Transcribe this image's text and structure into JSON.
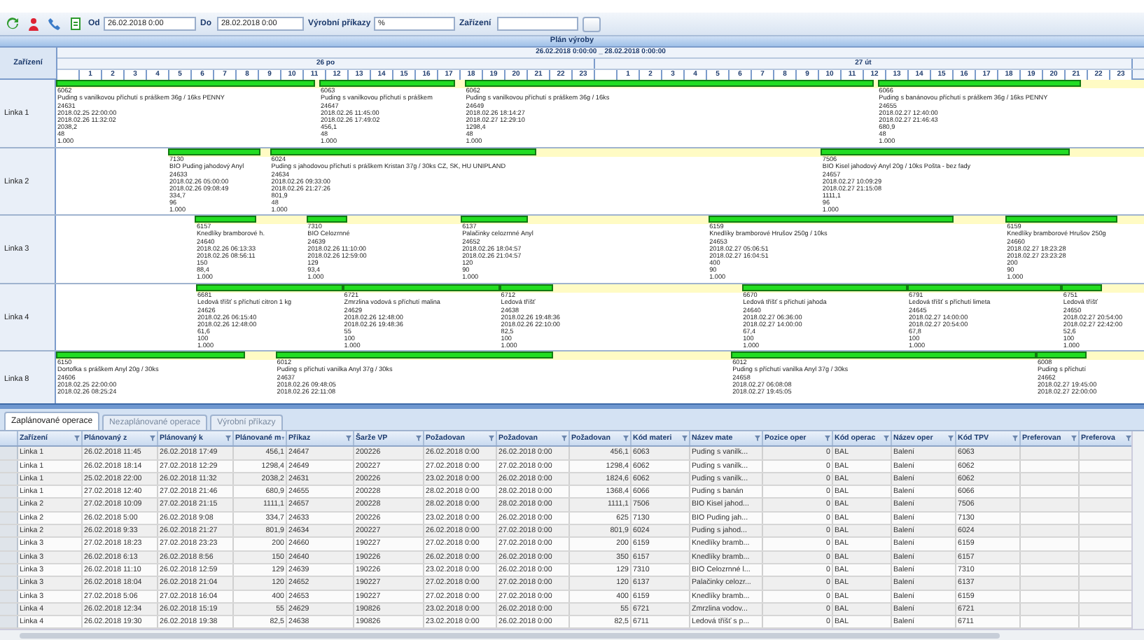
{
  "toolbar": {
    "from_label": "Od",
    "from_value": "26.02.2018 0:00",
    "to_label": "Do",
    "to_value": "28.02.2018 0:00",
    "orders_label": "Výrobní příkazy",
    "orders_value": "%",
    "device_label": "Zařízení"
  },
  "gantt": {
    "title": "Plán výroby",
    "range": "26.02.2018 0:00:00 _ 28.02.2018 0:00:00",
    "resource_header": "Zařízení",
    "days": [
      {
        "label": "26 po",
        "hours": [
          "1",
          "2",
          "3",
          "4",
          "5",
          "6",
          "7",
          "8",
          "9",
          "10",
          "11",
          "12",
          "13",
          "14",
          "15",
          "16",
          "17",
          "18",
          "19",
          "20",
          "21",
          "22",
          "23"
        ]
      },
      {
        "label": "27 út",
        "hours": [
          "1",
          "2",
          "3",
          "4",
          "5",
          "6",
          "7",
          "8",
          "9",
          "10",
          "11",
          "12",
          "13",
          "14",
          "15",
          "16",
          "17",
          "18",
          "19",
          "20",
          "21",
          "22",
          "23"
        ]
      }
    ],
    "resources": [
      {
        "name": "Linka 1",
        "tasks": [
          {
            "code": "6062",
            "name": "Puding s vanilkovou příchutí s práškem 36g / 16ks PENNY",
            "order": "24631",
            "start": "2018.02.25 22:00:00",
            "end": "2018.02.26 11:32:02",
            "lines": [
              "2038,2",
              "48",
              "1.000"
            ]
          },
          {
            "code": "6063",
            "name": "Puding s vanilkovou příchutí s práškem",
            "order": "24647",
            "start": "2018.02.26 11:45:00",
            "end": "2018.02.26 17:49:02",
            "lines": [
              "456,1",
              "48",
              "1.000"
            ]
          },
          {
            "code": "6062",
            "name": "Puding s vanilkovou příchutí s práškem 36g / 16ks",
            "order": "24649",
            "start": "2018.02.26 18:14:27",
            "end": "2018.02.27 12:29:10",
            "lines": [
              "1298,4",
              "48",
              "1.000"
            ]
          },
          {
            "code": "6066",
            "name": "Puding s banánovou příchutí s práškem 36g / 16ks PENNY",
            "order": "24655",
            "start": "2018.02.27 12:40:00",
            "end": "2018.02.27 21:46:43",
            "lines": [
              "680,9",
              "48",
              "1.000"
            ]
          }
        ]
      },
      {
        "name": "Linka 2",
        "tasks": [
          {
            "code": "7130",
            "name": "BIO Puding jahodový Anyl",
            "order": "24633",
            "start": "2018.02.26 05:00:00",
            "end": "2018.02.26 09:08:49",
            "lines": [
              "334,7",
              "96",
              "1.000"
            ]
          },
          {
            "code": "6024",
            "name": "Puding s jahodovou příchutí s práškem Kristan 37g / 30ks CZ, SK, HU UNIPLAND",
            "order": "24634",
            "start": "2018.02.26 09:33:00",
            "end": "2018.02.26 21:27:26",
            "lines": [
              "801,9",
              "48",
              "1.000"
            ]
          },
          {
            "code": "7506",
            "name": "BIO Kisel jahodový Anyl 20g / 10ks Pošta - bez fady",
            "order": "24657",
            "start": "2018.02.27 10:09:29",
            "end": "2018.02.27 21:15:08",
            "lines": [
              "1111,1",
              "96",
              "1.000"
            ]
          }
        ]
      },
      {
        "name": "Linka 3",
        "tasks": [
          {
            "code": "6157",
            "name": "Knedlíky bramborové h.",
            "order": "24640",
            "start": "2018.02.26 06:13:33",
            "end": "2018.02.26 08:56:11",
            "lines": [
              "150",
              "88,4",
              "1.000"
            ]
          },
          {
            "code": "7310",
            "name": "BIO Celozrnné",
            "order": "24639",
            "start": "2018.02.26 11:10:00",
            "end": "2018.02.26 12:59:00",
            "lines": [
              "129",
              "93,4",
              "1.000"
            ]
          },
          {
            "code": "6137",
            "name": "Palačinky celozrnné Anyl",
            "order": "24652",
            "start": "2018.02.26 18:04:57",
            "end": "2018.02.26 21:04:57",
            "lines": [
              "120",
              "90",
              "1.000"
            ]
          },
          {
            "code": "6159",
            "name": "Knedlíky bramborové Hrušov 250g / 10ks",
            "order": "24653",
            "start": "2018.02.27 05:06:51",
            "end": "2018.02.27 16:04:51",
            "lines": [
              "400",
              "90",
              "1.000"
            ]
          },
          {
            "code": "6159",
            "name": "Knedlíky bramborové Hrušov 250g",
            "order": "24660",
            "start": "2018.02.27 18:23:28",
            "end": "2018.02.27 23:23:28",
            "lines": [
              "200",
              "90",
              "1.000"
            ]
          }
        ]
      },
      {
        "name": "Linka 4",
        "tasks": [
          {
            "code": "6681",
            "name": "Ledová tříšť s příchutí citron 1 kg",
            "order": "24626",
            "start": "2018.02.26 06:15:40",
            "end": "2018.02.26 12:48:00",
            "lines": [
              "61,6",
              "100",
              "1.000"
            ]
          },
          {
            "code": "6721",
            "name": "Zmrzlina vodová s příchutí malina",
            "order": "24629",
            "start": "2018.02.26 12:48:00",
            "end": "2018.02.26 19:48:36",
            "lines": [
              "55",
              "100",
              "1.000"
            ]
          },
          {
            "code": "6712",
            "name": "Ledová tříšť",
            "order": "24638",
            "start": "2018.02.26 19:48:36",
            "end": "2018.02.26 22:10:00",
            "lines": [
              "82,5",
              "100",
              "1.000"
            ]
          },
          {
            "code": "6670",
            "name": "Ledová tříšť s příchutí jahoda",
            "order": "24640",
            "start": "2018.02.27 06:36:00",
            "end": "2018.02.27 14:00:00",
            "lines": [
              "67,4",
              "100",
              "1.000"
            ]
          },
          {
            "code": "6791",
            "name": "Ledová tříšť s příchutí limeta",
            "order": "24645",
            "start": "2018.02.27 14:00:00",
            "end": "2018.02.27 20:54:00",
            "lines": [
              "67,8",
              "100",
              "1.000"
            ]
          },
          {
            "code": "6751",
            "name": "Ledová tříšť",
            "order": "24650",
            "start": "2018.02.27 20:54:00",
            "end": "2018.02.27 22:42:00",
            "lines": [
              "52,6",
              "100",
              "1.000"
            ]
          }
        ]
      },
      {
        "name": "Linka 8",
        "tasks": [
          {
            "code": "6150",
            "name": "Dortofka s práškem Anyl 20g / 30ks",
            "order": "24606",
            "start": "2018.02.25 22:00:00",
            "end": "2018.02.26 08:25:24"
          },
          {
            "code": "6012",
            "name": "Puding s příchutí vanilka Anyl 37g / 30ks",
            "order": "24637",
            "start": "2018.02.26 09:48:05",
            "end": "2018.02.26 22:11:08"
          },
          {
            "code": "6012",
            "name": "Puding s příchutí vanilka Anyl 37g / 30ks",
            "order": "24658",
            "start": "2018.02.27 06:08:08",
            "end": "2018.02.27 19:45:05"
          },
          {
            "code": "6008",
            "name": "Puding s příchutí",
            "order": "24662",
            "start": "2018.02.27 19:45:00",
            "end": "2018.02.27 22:00:00"
          }
        ]
      }
    ]
  },
  "tabs": [
    {
      "label": "Zaplánované operace",
      "selected": true
    },
    {
      "label": "Nezaplánované operace",
      "selected": false
    },
    {
      "label": "Výrobní příkazy",
      "selected": false
    }
  ],
  "table": {
    "columns": [
      {
        "label": "Zařízení",
        "kind": "text"
      },
      {
        "label": "Plánovaný z",
        "kind": "text"
      },
      {
        "label": "Plánovaný k",
        "kind": "text"
      },
      {
        "label": "Plánované m",
        "kind": "number"
      },
      {
        "label": "Příkaz",
        "kind": "text"
      },
      {
        "label": "Šarže VP",
        "kind": "text"
      },
      {
        "label": "Požadovan",
        "kind": "text"
      },
      {
        "label": "Požadovan",
        "kind": "text"
      },
      {
        "label": "Požadovan",
        "kind": "number"
      },
      {
        "label": "Kód materi",
        "kind": "text"
      },
      {
        "label": "Název mate",
        "kind": "text"
      },
      {
        "label": "Pozice oper",
        "kind": "number"
      },
      {
        "label": "Kód operac",
        "kind": "text"
      },
      {
        "label": "Název oper",
        "kind": "text"
      },
      {
        "label": "Kód TPV",
        "kind": "text"
      },
      {
        "label": "Preferovan"
      },
      {
        "label": "Preferova"
      }
    ],
    "rows": [
      [
        "Linka 1",
        "26.02.2018 11:45",
        "26.02.2018 17:49",
        "456,1",
        "24647",
        "200226",
        "26.02.2018 0:00",
        "26.02.2018 0:00",
        "456,1",
        "6063",
        "Puding s vanilk...",
        "0",
        "BAL",
        "Balení",
        "6063"
      ],
      [
        "Linka 1",
        "26.02.2018 18:14",
        "27.02.2018 12:29",
        "1298,4",
        "24649",
        "200227",
        "27.02.2018 0:00",
        "27.02.2018 0:00",
        "1298,4",
        "6062",
        "Puding s vanilk...",
        "0",
        "BAL",
        "Balení",
        "6062"
      ],
      [
        "Linka 1",
        "25.02.2018 22:00",
        "26.02.2018 11:32",
        "2038,2",
        "24631",
        "200226",
        "23.02.2018 0:00",
        "26.02.2018 0:00",
        "1824,6",
        "6062",
        "Puding s vanilk...",
        "0",
        "BAL",
        "Balení",
        "6062"
      ],
      [
        "Linka 1",
        "27.02.2018 12:40",
        "27.02.2018 21:46",
        "680,9",
        "24655",
        "200228",
        "28.02.2018 0:00",
        "28.02.2018 0:00",
        "1368,4",
        "6066",
        "Puding s banán",
        "0",
        "BAL",
        "Balení",
        "6066"
      ],
      [
        "Linka 2",
        "27.02.2018 10:09",
        "27.02.2018 21:15",
        "1111,1",
        "24657",
        "200228",
        "28.02.2018 0:00",
        "28.02.2018 0:00",
        "1111,1",
        "7506",
        "BIO Kisel jahod...",
        "0",
        "BAL",
        "Balení",
        "7506"
      ],
      [
        "Linka 2",
        "26.02.2018 5:00",
        "26.02.2018 9:08",
        "334,7",
        "24633",
        "200226",
        "23.02.2018 0:00",
        "26.02.2018 0:00",
        "625",
        "7130",
        "BIO Puding jah...",
        "0",
        "BAL",
        "Balení",
        "7130"
      ],
      [
        "Linka 2",
        "26.02.2018 9:33",
        "26.02.2018 21:27",
        "801,9",
        "24634",
        "200227",
        "26.02.2018 0:00",
        "27.02.2018 0:00",
        "801,9",
        "6024",
        "Puding s jahod...",
        "0",
        "BAL",
        "Balení",
        "6024"
      ],
      [
        "Linka 3",
        "27.02.2018 18:23",
        "27.02.2018 23:23",
        "200",
        "24660",
        "190227",
        "27.02.2018 0:00",
        "27.02.2018 0:00",
        "200",
        "6159",
        "Knedlíky bramb...",
        "0",
        "BAL",
        "Balení",
        "6159"
      ],
      [
        "Linka 3",
        "26.02.2018 6:13",
        "26.02.2018 8:56",
        "150",
        "24640",
        "190226",
        "26.02.2018 0:00",
        "26.02.2018 0:00",
        "350",
        "6157",
        "Knedlíky bramb...",
        "0",
        "BAL",
        "Balení",
        "6157"
      ],
      [
        "Linka 3",
        "26.02.2018 11:10",
        "26.02.2018 12:59",
        "129",
        "24639",
        "190226",
        "23.02.2018 0:00",
        "26.02.2018 0:00",
        "129",
        "7310",
        "BIO Celozrnné l...",
        "0",
        "BAL",
        "Balení",
        "7310"
      ],
      [
        "Linka 3",
        "26.02.2018 18:04",
        "26.02.2018 21:04",
        "120",
        "24652",
        "190227",
        "27.02.2018 0:00",
        "27.02.2018 0:00",
        "120",
        "6137",
        "Palačinky celozr...",
        "0",
        "BAL",
        "Balení",
        "6137"
      ],
      [
        "Linka 3",
        "27.02.2018 5:06",
        "27.02.2018 16:04",
        "400",
        "24653",
        "190227",
        "27.02.2018 0:00",
        "27.02.2018 0:00",
        "400",
        "6159",
        "Knedlíky bramb...",
        "0",
        "BAL",
        "Balení",
        "6159"
      ],
      [
        "Linka 4",
        "26.02.2018 12:34",
        "26.02.2018 15:19",
        "55",
        "24629",
        "190826",
        "23.02.2018 0:00",
        "26.02.2018 0:00",
        "55",
        "6721",
        "Zmrzlina vodov...",
        "0",
        "BAL",
        "Balení",
        "6721"
      ],
      [
        "Linka 4",
        "26.02.2018 19:30",
        "26.02.2018 19:38",
        "82,5",
        "24638",
        "190826",
        "23.02.2018 0:00",
        "26.02.2018 0:00",
        "82,5",
        "6711",
        "Ledová tříšť s p...",
        "0",
        "BAL",
        "Balení",
        "6711"
      ]
    ]
  }
}
